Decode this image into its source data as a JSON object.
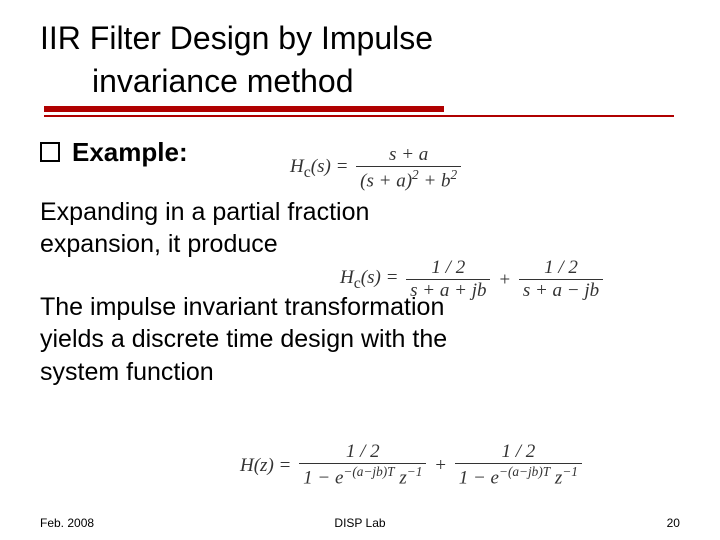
{
  "title": {
    "line1": "IIR Filter Design by Impulse",
    "line2": "invariance method"
  },
  "bullet": {
    "label": "Example:"
  },
  "para1": {
    "line1": "Expanding  in a partial fraction",
    "line2": "expansion, it produce"
  },
  "para2": {
    "line1": "The impulse invariant transformation",
    "line2": "yields a discrete time design with the",
    "line3": "system function"
  },
  "formula1": {
    "lhs": "H",
    "sub": "c",
    "arg": "(s)",
    "eq": " = ",
    "num": "s + a",
    "den_left": "(s + a)",
    "den_exp": "2",
    "den_mid": " + b",
    "den_exp2": "2"
  },
  "formula2": {
    "lhs": "H",
    "sub": "c",
    "arg": "(s)",
    "eq": " = ",
    "t1_num": "1 / 2",
    "t1_den": "s + a + jb",
    "plus": " + ",
    "t2_num": "1 / 2",
    "t2_den": "s + a − jb"
  },
  "formula3": {
    "lhs": "H",
    "arg": "(z)",
    "eq": " = ",
    "t1_num": "1 / 2",
    "t1_den_a": "1 − e",
    "t1_den_exp": "−(a−jb)T",
    "t1_den_b": " z",
    "t1_den_bexp": "−1",
    "plus": " + ",
    "t2_num": "1 / 2",
    "t2_den_a": "1 − e",
    "t2_den_exp": "−(a−jb)T",
    "t2_den_b": " z",
    "t2_den_bexp": "−1"
  },
  "footer": {
    "date": "Feb. 2008",
    "lab": "DISP Lab",
    "page": "20"
  }
}
